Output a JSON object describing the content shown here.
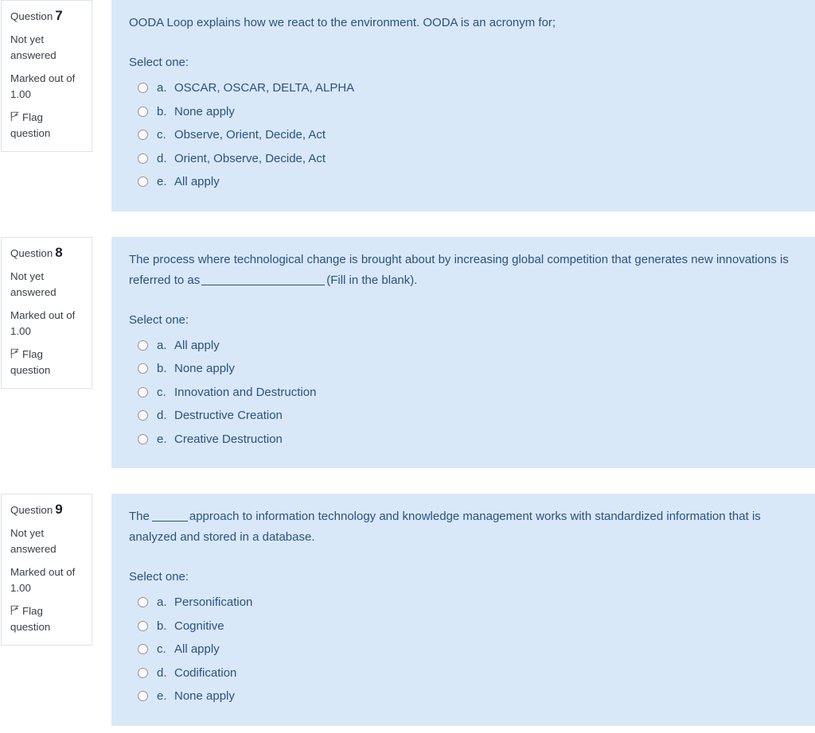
{
  "theme": {
    "panel_bg": "#d9e8f8",
    "panel_text": "#2a5182",
    "info_border": "#dee2e6",
    "info_text": "#3b4045",
    "page_bg": "#ffffff"
  },
  "labels": {
    "question_word": "Question",
    "status": "Not yet answered",
    "marked_out_of": "Marked out of 1.00",
    "flag_label": "Flag question",
    "select_one": "Select one:",
    "flag_icon": "flag-outline-icon",
    "radio_icon": "radio-unchecked-icon"
  },
  "questions": [
    {
      "number": "7",
      "status": "Not yet answered",
      "marks": "Marked out of 1.00",
      "flag": "Flag question",
      "text_parts": {
        "before": "OODA Loop explains how we react to the environment. OODA is an acronym for;",
        "blank": "none",
        "after": ""
      },
      "select_label": "Select one:",
      "options": [
        {
          "letter": "a.",
          "text": "OSCAR, OSCAR, DELTA, ALPHA"
        },
        {
          "letter": "b.",
          "text": "None apply"
        },
        {
          "letter": "c.",
          "text": "Observe, Orient, Decide, Act"
        },
        {
          "letter": "d.",
          "text": "Orient, Observe, Decide, Act"
        },
        {
          "letter": "e.",
          "text": "All apply"
        }
      ]
    },
    {
      "number": "8",
      "status": "Not yet answered",
      "marks": "Marked out of 1.00",
      "flag": "Flag question",
      "text_parts": {
        "before": "The process where technological change is brought about by increasing global competition that generates new innovations is referred to as",
        "blank": "long",
        "after": "(Fill in the blank)."
      },
      "select_label": "Select one:",
      "options": [
        {
          "letter": "a.",
          "text": "All apply"
        },
        {
          "letter": "b.",
          "text": "None apply"
        },
        {
          "letter": "c.",
          "text": "Innovation and Destruction"
        },
        {
          "letter": "d.",
          "text": "Destructive Creation"
        },
        {
          "letter": "e.",
          "text": "Creative Destruction"
        }
      ]
    },
    {
      "number": "9",
      "status": "Not yet answered",
      "marks": "Marked out of 1.00",
      "flag": "Flag question",
      "text_parts": {
        "before": "The",
        "blank": "short",
        "after": "approach to information technology and knowledge management works with standardized information that is analyzed and stored in a database."
      },
      "select_label": "Select one:",
      "options": [
        {
          "letter": "a.",
          "text": "Personification"
        },
        {
          "letter": "b.",
          "text": "Cognitive"
        },
        {
          "letter": "c.",
          "text": "All apply"
        },
        {
          "letter": "d.",
          "text": "Codification"
        },
        {
          "letter": "e.",
          "text": "None apply"
        }
      ]
    }
  ]
}
